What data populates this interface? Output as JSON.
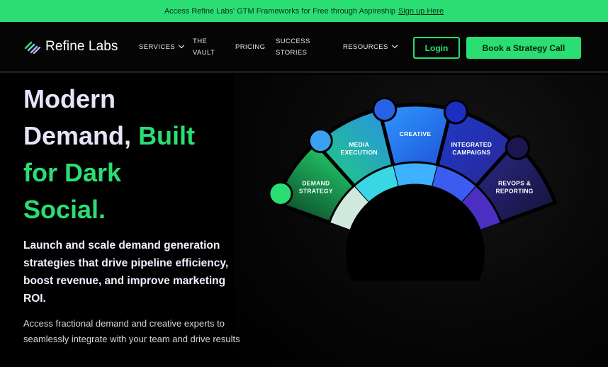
{
  "banner": {
    "text": "Access Refine Labs' GTM Frameworks for Free through Aspireship",
    "link": "Sign up Here"
  },
  "nav": {
    "logo": "Refine Labs",
    "services": "SERVICES",
    "vault_line1": "THE",
    "vault_line2": "VAULT",
    "pricing": "PRICING",
    "stories_line1": "SUCCESS",
    "stories_line2": "STORIES",
    "resources": "RESOURCES",
    "login": "Login",
    "cta": "Book a Strategy Call"
  },
  "hero": {
    "title_line1": "Modern",
    "title_line2a": "Demand,",
    "title_line2b": "Built",
    "title_line3": "for Dark",
    "title_line4": "Social.",
    "subtitle": "Launch and scale demand generation strategies that drive pipeline efficiency, boost revenue, and improve marketing ROI.",
    "body": "Access fractional demand and creative experts to seamlessly integrate with your team and drive results"
  },
  "wheel": {
    "segments": [
      {
        "line1": "DEMAND",
        "line2": "STRATEGY"
      },
      {
        "line1": "MEDIA",
        "line2": "EXECUTION"
      },
      {
        "line1": "CREATIVE",
        "line2": ""
      },
      {
        "line1": "INTEGRATED",
        "line2": "CAMPAIGNS"
      },
      {
        "line1": "REVOPS &",
        "line2": "REPORTING"
      }
    ]
  },
  "colors": {
    "accent": "#2bde73",
    "title": "#e6e4f8"
  }
}
